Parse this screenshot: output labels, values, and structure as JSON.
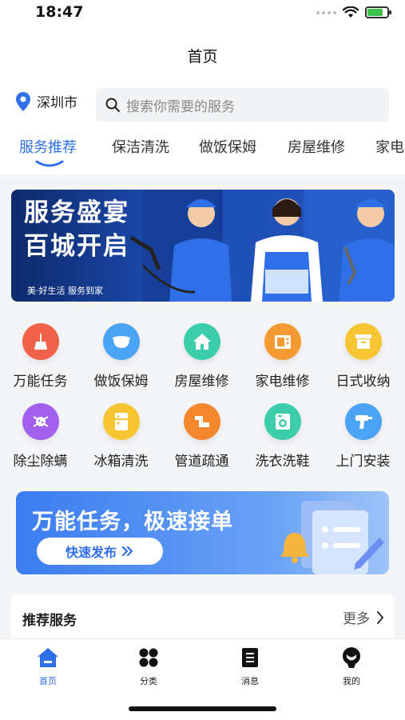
{
  "status": {
    "time": "18:47"
  },
  "nav": {
    "title": "首页"
  },
  "location": {
    "city": "深圳市"
  },
  "search": {
    "placeholder": "搜索你需要的服务"
  },
  "tabs": [
    {
      "label": "服务推荐",
      "active": true
    },
    {
      "label": "保洁清洗"
    },
    {
      "label": "做饭保姆"
    },
    {
      "label": "房屋维修"
    },
    {
      "label": "家电"
    }
  ],
  "banner": {
    "title_line1": "服务盛宴",
    "title_line2": "百城开启",
    "tagline": "美·好生活  服务到家"
  },
  "services": [
    {
      "label": "万能任务",
      "icon": "broom-icon",
      "color": "#f0624a"
    },
    {
      "label": "做饭保姆",
      "icon": "pot-icon",
      "color": "#4aa3f5"
    },
    {
      "label": "房屋维修",
      "icon": "house-icon",
      "color": "#3ccdaa"
    },
    {
      "label": "家电维修",
      "icon": "appliance-icon",
      "color": "#f59a32"
    },
    {
      "label": "日式收纳",
      "icon": "storage-box-icon",
      "color": "#f7c531"
    },
    {
      "label": "除尘除螨",
      "icon": "mite-icon",
      "color": "#a160ee"
    },
    {
      "label": "冰箱清洗",
      "icon": "fridge-icon",
      "color": "#f7c531"
    },
    {
      "label": "管道疏通",
      "icon": "pipe-icon",
      "color": "#f5872f"
    },
    {
      "label": "洗衣洗鞋",
      "icon": "washing-machine-icon",
      "color": "#3ccdaa"
    },
    {
      "label": "上门安装",
      "icon": "drill-icon",
      "color": "#4aa3f5"
    }
  ],
  "promo": {
    "title": "万能任务，极速接单",
    "button": "快速发布"
  },
  "recommend": {
    "title": "推荐服务",
    "more": "更多"
  },
  "tabbar": [
    {
      "label": "首页",
      "icon": "home-icon",
      "active": true
    },
    {
      "label": "分类",
      "icon": "category-icon"
    },
    {
      "label": "消息",
      "icon": "message-icon"
    },
    {
      "label": "我的",
      "icon": "profile-icon"
    }
  ],
  "colors": {
    "accent": "#2f6fe8",
    "battery": "#3cc24a"
  }
}
